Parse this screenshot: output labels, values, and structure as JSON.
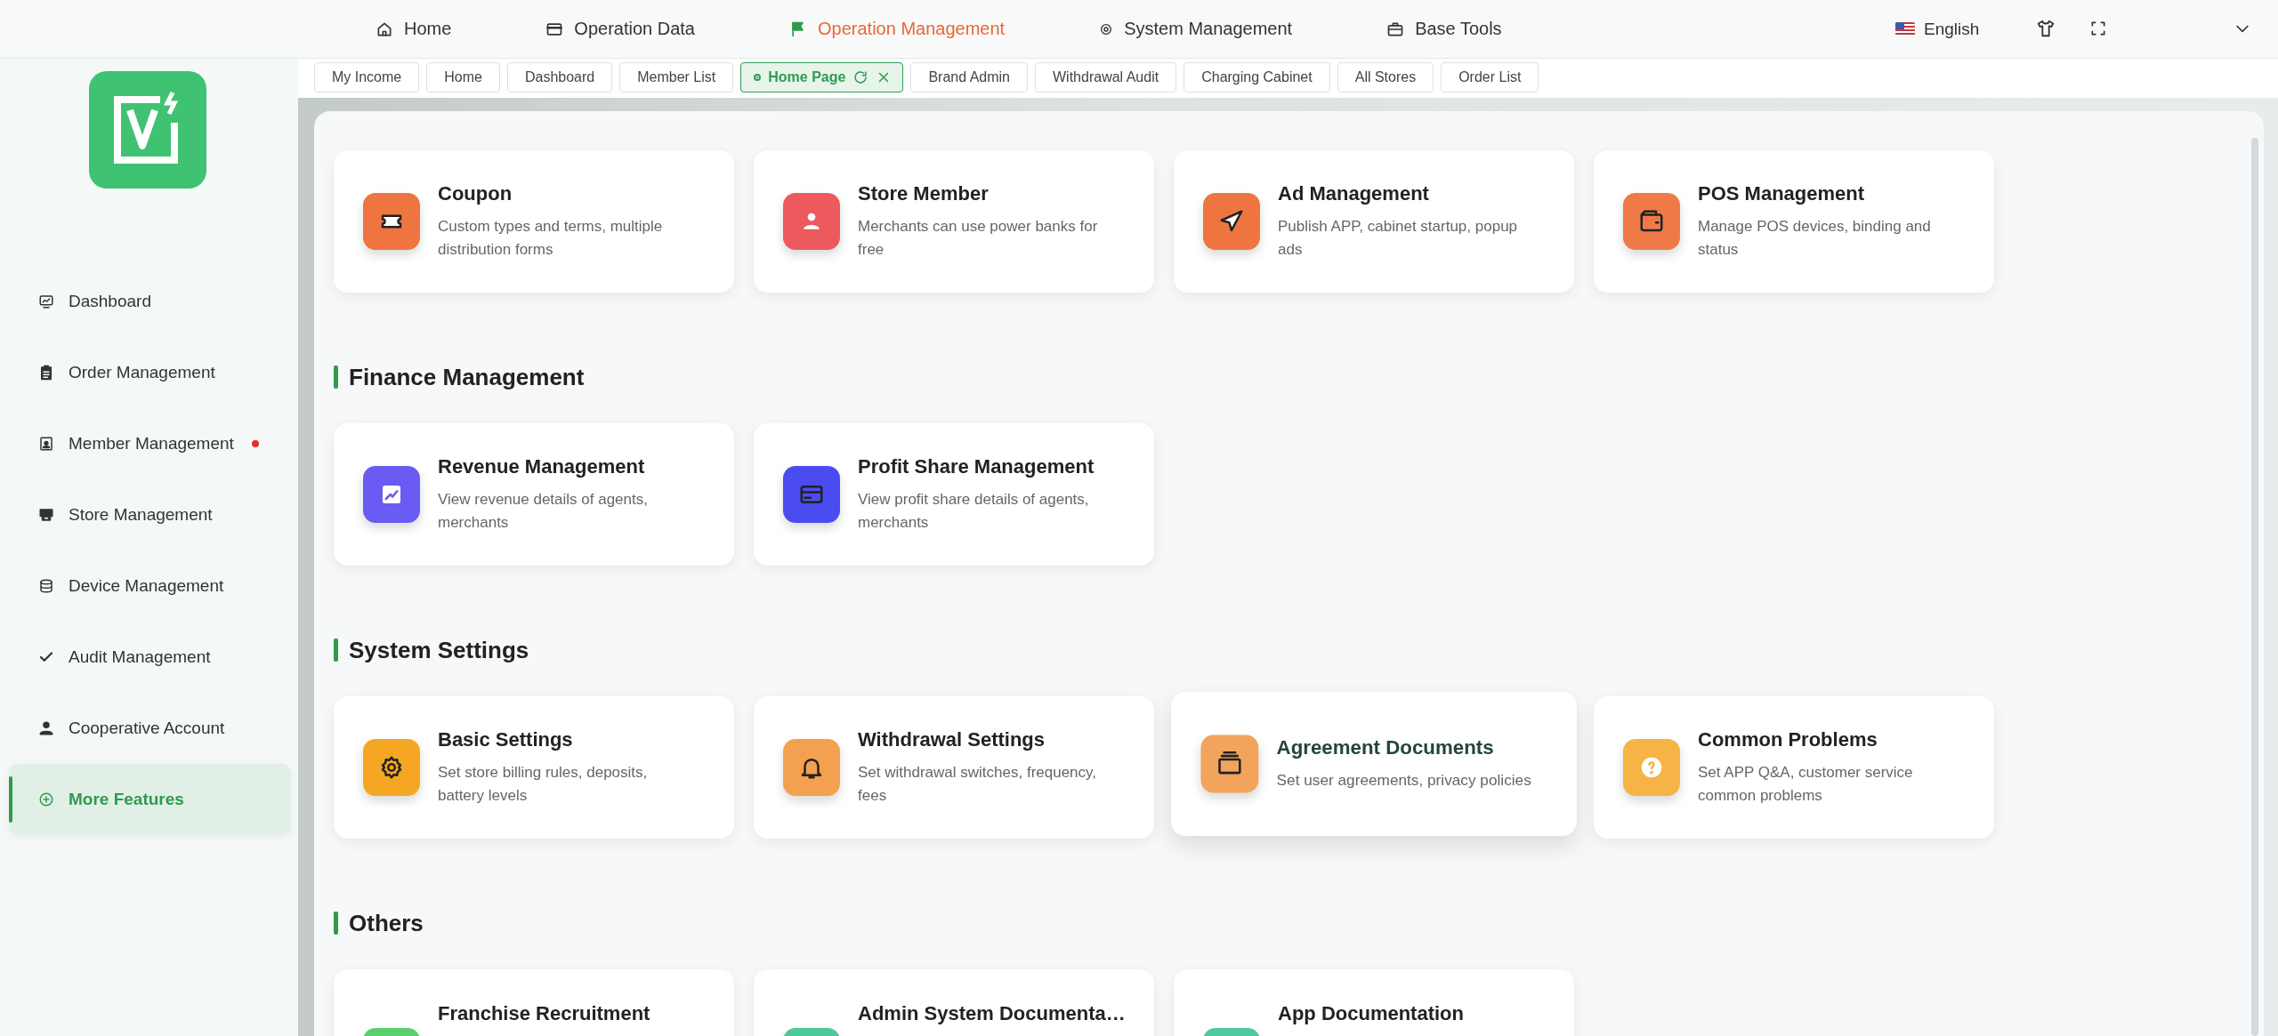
{
  "top_nav": {
    "items": [
      {
        "label": "Home",
        "selected": false
      },
      {
        "label": "Operation Data",
        "selected": false
      },
      {
        "label": "Operation Management",
        "selected": true
      },
      {
        "label": "System Management",
        "selected": false
      },
      {
        "label": "Base Tools",
        "selected": false
      }
    ],
    "language": "English"
  },
  "sidebar": {
    "items": [
      {
        "label": "Dashboard",
        "selected": false,
        "notification": false
      },
      {
        "label": "Order Management",
        "selected": false,
        "notification": false
      },
      {
        "label": "Member Management",
        "selected": false,
        "notification": true
      },
      {
        "label": "Store Management",
        "selected": false,
        "notification": false
      },
      {
        "label": "Device Management",
        "selected": false,
        "notification": false
      },
      {
        "label": "Audit Management",
        "selected": false,
        "notification": false
      },
      {
        "label": "Cooperative Account",
        "selected": false,
        "notification": false
      },
      {
        "label": "More Features",
        "selected": true,
        "notification": false
      }
    ]
  },
  "tabs": [
    {
      "label": "My Income",
      "selected": false
    },
    {
      "label": "Home",
      "selected": false
    },
    {
      "label": "Dashboard",
      "selected": false
    },
    {
      "label": "Member List",
      "selected": false
    },
    {
      "label": "Home Page",
      "selected": true
    },
    {
      "label": "Brand Admin",
      "selected": false
    },
    {
      "label": "Withdrawal Audit",
      "selected": false
    },
    {
      "label": "Charging Cabinet",
      "selected": false
    },
    {
      "label": "All Stores",
      "selected": false
    },
    {
      "label": "Order List",
      "selected": false
    }
  ],
  "sections": [
    {
      "cards": [
        {
          "title": "Coupon",
          "description": "Custom types and terms, multiple distribution forms",
          "color": "#ee7440",
          "hovered": false
        },
        {
          "title": "Store Member",
          "description": "Merchants can use power banks for free",
          "color": "#ec5a5e",
          "hovered": false
        },
        {
          "title": "Ad Management",
          "description": "Publish APP, cabinet startup, popup ads",
          "color": "#ef7540",
          "hovered": false
        },
        {
          "title": "POS Management",
          "description": "Manage POS devices, binding and status",
          "color": "#ef7a48",
          "hovered": false
        }
      ]
    },
    {
      "title": "Finance Management",
      "cards": [
        {
          "title": "Revenue Management",
          "description": "View revenue details of agents, merchants",
          "color": "#6a5cf2",
          "hovered": false
        },
        {
          "title": "Profit Share Management",
          "description": "View profit share details of agents, merchants",
          "color": "#4b4cf0",
          "hovered": false
        }
      ]
    },
    {
      "title": "System Settings",
      "cards": [
        {
          "title": "Basic Settings",
          "description": "Set store billing rules, deposits, battery levels",
          "color": "#f5a623",
          "hovered": false
        },
        {
          "title": "Withdrawal Settings",
          "description": "Set withdrawal switches, frequency, fees",
          "color": "#f3a050",
          "hovered": false
        },
        {
          "title": "Agreement Documents",
          "description": "Set user agreements, privacy policies",
          "color": "#f2a45c",
          "hovered": true
        },
        {
          "title": "Common Problems",
          "description": "Set APP Q&A, customer service common problems",
          "color": "#f6b446",
          "hovered": false
        }
      ]
    },
    {
      "title": "Others",
      "cards": [
        {
          "title": "Franchise Recruitment",
          "color": "#5bcf6c",
          "hovered": false
        },
        {
          "title": "Admin System Documenta…",
          "color": "#4cc99a",
          "hovered": false
        },
        {
          "title": "App Documentation",
          "color": "#4dc8a0",
          "hovered": false
        }
      ]
    }
  ]
}
